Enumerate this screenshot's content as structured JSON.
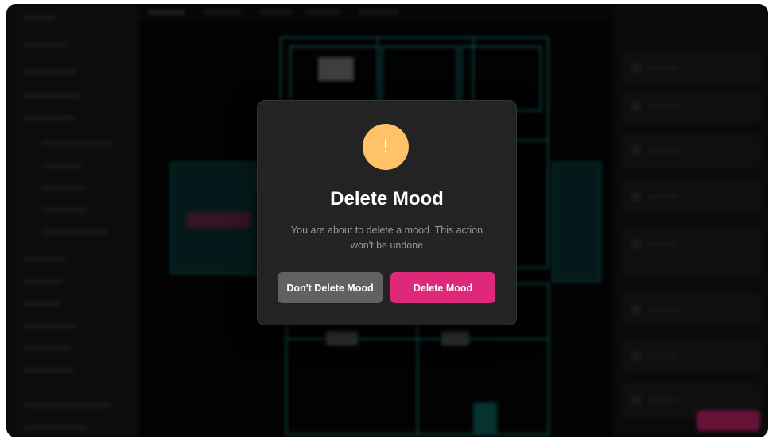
{
  "dialog": {
    "icon": "warning-exclamation-icon",
    "icon_glyph": "!",
    "title": "Delete Mood",
    "message": "You are about to delete a mood. This action won't be undone",
    "cancel_label": "Don't Delete Mood",
    "confirm_label": "Delete Mood"
  },
  "colors": {
    "accent_pink": "#e0287a",
    "warning_yellow": "#ffc266",
    "cancel_gray": "#616161",
    "modal_bg": "#232323"
  }
}
